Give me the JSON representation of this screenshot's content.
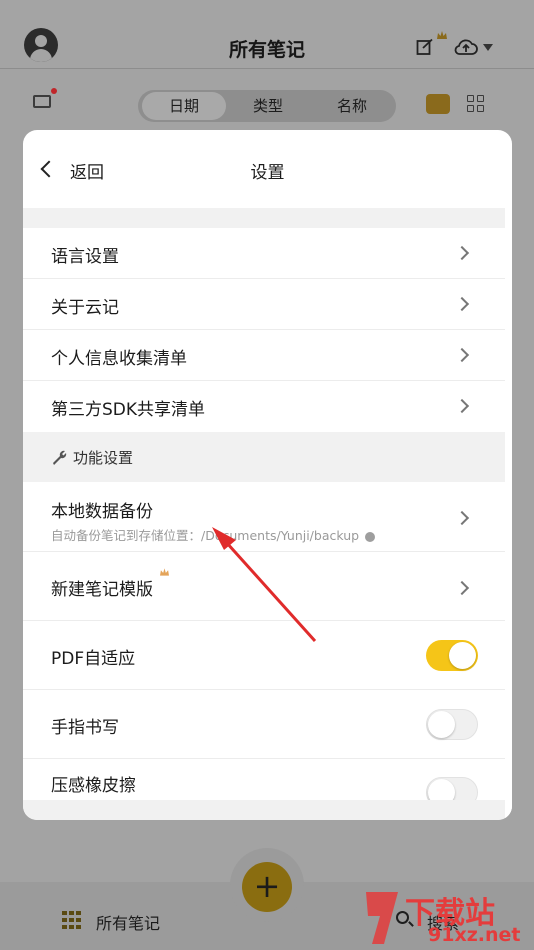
{
  "header": {
    "title": "所有笔记",
    "icons": [
      "avatar-icon",
      "edit-note-icon",
      "crown-icon",
      "cloud-upload-icon",
      "caret-down-icon"
    ]
  },
  "filter": {
    "tabs": [
      {
        "label": "日期",
        "active": true
      },
      {
        "label": "类型",
        "active": false
      },
      {
        "label": "名称",
        "active": false
      }
    ]
  },
  "settings": {
    "back_label": "返回",
    "title": "设置",
    "items": [
      {
        "label": "语言设置"
      },
      {
        "label": "关于云记"
      },
      {
        "label": "个人信息收集清单"
      },
      {
        "label": "第三方SDK共享清单"
      }
    ],
    "section_title": "功能设置",
    "backup": {
      "label": "本地数据备份",
      "sub": "自动备份笔记到存储位置：/Documents/Yunji/backup"
    },
    "template_label": "新建笔记模版",
    "pdf_label": "PDF自适应",
    "pdf_on": true,
    "finger_label": "手指书写",
    "finger_on": false,
    "pressure_label": "压感橡皮擦",
    "pressure_on": false
  },
  "bottom": {
    "all_notes_label": "所有笔记",
    "search_label": "搜索",
    "fab_glyph": "+"
  },
  "watermark": {
    "big": "下载站",
    "small": "91xz.net"
  },
  "colors": {
    "accent": "#f5c518",
    "annotation_arrow": "#e02b2b",
    "overlay": "#a3a3a3"
  }
}
